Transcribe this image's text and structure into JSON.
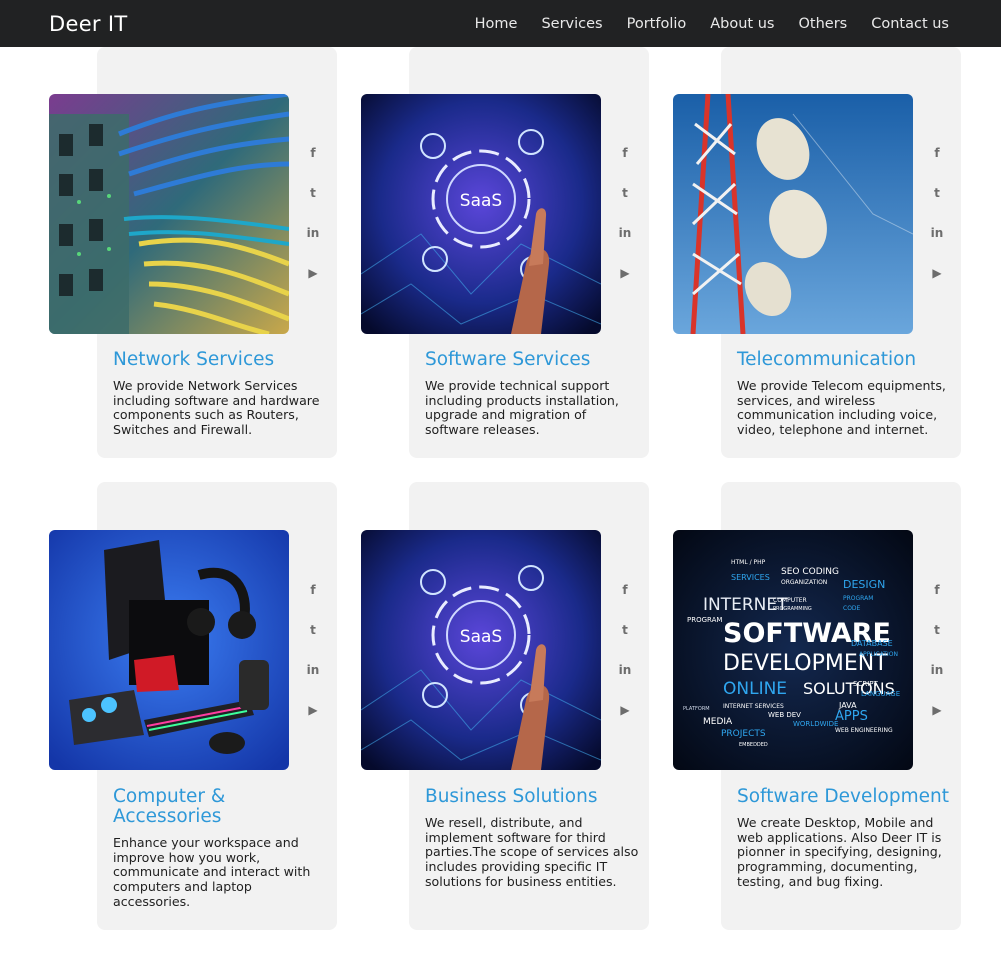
{
  "nav": {
    "brand": "Deer IT",
    "links": [
      "Home",
      "Services",
      "Portfolio",
      "About us",
      "Others",
      "Contact us"
    ]
  },
  "social_icons": [
    "facebook-icon",
    "twitter-icon",
    "linkedin-icon",
    "youtube-icon"
  ],
  "social_glyphs": [
    "f",
    "t",
    "in",
    "▶"
  ],
  "cards": [
    {
      "title": "Network Services",
      "text": "We provide Network Services including software and hardware components such as Routers, Switches and Firewall.",
      "image": "network-cables-image"
    },
    {
      "title": "Software Services",
      "text": "We provide technical support including products installation, upgrade and migration of software releases.",
      "image": "saas-hand-image"
    },
    {
      "title": "Telecommunication",
      "text": "We provide Telecom equipments, services, and wireless communication including voice, video, telephone and internet.",
      "image": "telecom-tower-image"
    },
    {
      "title": "Computer & Accessories",
      "text": "Enhance your workspace and improve how you work, communicate and interact with computers and laptop accessories.",
      "image": "computer-accessories-image"
    },
    {
      "title": "Business Solutions",
      "text": "We resell, distribute, and implement software for third parties.The scope of services also includes providing specific IT solutions for business entities.",
      "image": "saas-hand-image"
    },
    {
      "title": "Software Development",
      "text": "We create Desktop, Mobile and web applications. Also Deer IT is pionner in specifying, designing, programming, documenting, testing, and bug fixing.",
      "image": "software-development-wordcloud-image"
    }
  ],
  "wordcloud": {
    "big": [
      "SOFTWARE",
      "DEVELOPMENT",
      "INTERNET",
      "ONLINE",
      "SOLUTIONS"
    ],
    "small": [
      "HTML / PHP",
      "SERVICES",
      "SEO CODING",
      "ORGANIZATION",
      "DESIGN",
      "PROGRAM",
      "CODE",
      "COMPUTER",
      "PROGRAMMING",
      "DATABASE",
      "APPLICATION",
      "SCRIPT",
      "LANGUAGE",
      "JAVA",
      "APPS",
      "WEB ENGINEERING",
      "WORLDWIDE",
      "WEB DEV",
      "INTERNET SERVICES",
      "MEDIA",
      "PROJECTS",
      "EMBEDDED",
      "PLATFORM",
      "PROGRAM"
    ]
  },
  "saas_label": "SaaS",
  "colors": {
    "nav_bg": "#212223",
    "title": "#2e98d8",
    "card_bg": "#f2f2f2",
    "icon": "#6d6d6d"
  }
}
